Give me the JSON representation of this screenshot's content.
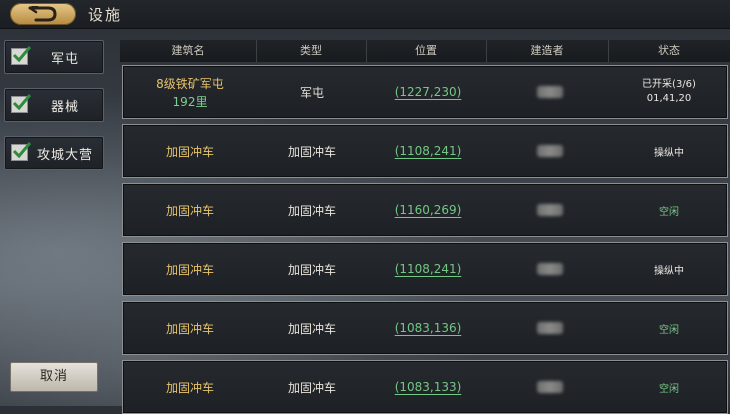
{
  "header": {
    "title": "设施"
  },
  "filters": [
    {
      "label": "军屯",
      "checked": true
    },
    {
      "label": "器械",
      "checked": true
    },
    {
      "label": "攻城大营",
      "checked": true
    }
  ],
  "cancel_label": "取消",
  "table": {
    "columns": [
      "建筑名",
      "类型",
      "位置",
      "建造者",
      "状态"
    ],
    "rows": [
      {
        "name": "8级铁矿军屯",
        "distance": "192里",
        "type": "军屯",
        "location": "(1227,230)",
        "status": "已开采(3/6)",
        "status_time": "01,41,20",
        "status_kind": "busy"
      },
      {
        "name": "加固冲车",
        "type": "加固冲车",
        "location": "(1108,241)",
        "status": "操纵中",
        "status_kind": "busy"
      },
      {
        "name": "加固冲车",
        "type": "加固冲车",
        "location": "(1160,269)",
        "status": "空闲",
        "status_kind": "idle"
      },
      {
        "name": "加固冲车",
        "type": "加固冲车",
        "location": "(1108,241)",
        "status": "操纵中",
        "status_kind": "busy"
      },
      {
        "name": "加固冲车",
        "type": "加固冲车",
        "location": "(1083,136)",
        "status": "空闲",
        "status_kind": "idle"
      },
      {
        "name": "加固冲车",
        "type": "加固冲车",
        "location": "(1083,133)",
        "status": "空闲",
        "status_kind": "idle"
      }
    ]
  },
  "colors": {
    "accent_gold": "#e8c46a",
    "link_green": "#74c784",
    "idle_green": "#79c989"
  }
}
